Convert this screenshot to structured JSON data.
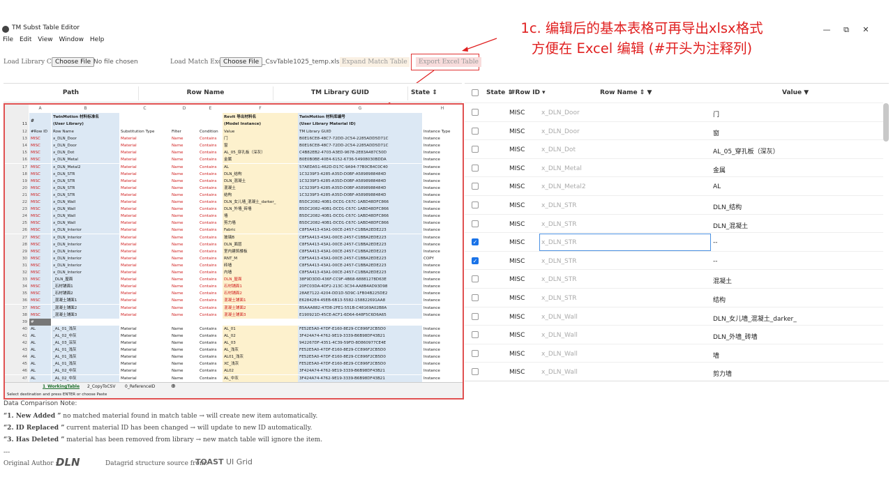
{
  "app": {
    "title": "TM Subst Table Editor"
  },
  "window_controls": [
    "—",
    "⧉",
    "✕"
  ],
  "menu": [
    "File",
    "Edit",
    "View",
    "Window",
    "Help"
  ],
  "annotation": {
    "line1": "1c. 编辑后的基本表格可再导出xlsx格式",
    "line2": "方便在 Excel 编辑 (#开头为注释列)"
  },
  "toolbar": {
    "load_library_label": "Load Library Csv :",
    "choose_file": "Choose File",
    "no_file": "No file chosen",
    "load_match_label": "Load Match Excel :",
    "match_file": "_CsvTable1025_temp.xlsx",
    "expand_match": "Expand Match Table",
    "export_excel": "Export Excel Table"
  },
  "left_header": [
    "Path",
    "Row Name",
    "TM Library GUID",
    "State ⇕"
  ],
  "spreadsheet": {
    "col_letters": [
      "A",
      "B",
      "C",
      "D",
      "E",
      "F",
      "G",
      "H"
    ],
    "header_b": [
      "TwinMotion 材料标准名",
      "(User Library)"
    ],
    "header_f": [
      "Revit 导出材料名",
      "(Model Instance)"
    ],
    "header_g": [
      "TwinMotion 材料库编号",
      "(User Library Material ID)"
    ],
    "header_a": "#",
    "col_header_row": [
      "12",
      "#Row ID",
      "Row Name",
      "Substitution Type",
      "Filter",
      "Condition",
      "Value",
      "TM Library GUID",
      "Instance Type"
    ],
    "rows": [
      [
        "13",
        "MISC",
        "x_DLN_Door",
        "Material",
        "Name",
        "Contains",
        "门",
        "B0E16CE8-48C7-72DD-2C54-2285ADD5D71C",
        "Instance"
      ],
      [
        "14",
        "MISC",
        "x_DLN_Door",
        "Material",
        "Name",
        "Contains",
        "窗",
        "B0E16CE8-48C7-72DD-2C54-2285ADD5D71C",
        "Instance"
      ],
      [
        "15",
        "MISC",
        "x_DLN_Dot",
        "Material",
        "Name",
        "Contains",
        "AL_05_穿孔板（深灰）",
        "C4B82EB2-4703-A3ED-9678-2E83A487C50D",
        "Instance"
      ],
      [
        "16",
        "MISC",
        "x_DLN_Metal",
        "Material",
        "Name",
        "Contains",
        "金属",
        "B0E0B0BE-40E4-6152-6736-54908030BDDA",
        "Instance"
      ],
      [
        "17",
        "MISC",
        "x_DLN_Metal2",
        "Material",
        "Name",
        "Contains",
        "AL",
        "57AEDA51-462D-D17C-9A94-77B0CB4C0C40",
        "Instance"
      ],
      [
        "18",
        "MISC",
        "x_DLN_STR",
        "Material",
        "Name",
        "Contains",
        "DLN_结构",
        "1C3239F3-4285-A35D-D0BF-A5898988484D",
        "Instance"
      ],
      [
        "19",
        "MISC",
        "x_DLN_STR",
        "Material",
        "Name",
        "Contains",
        "DLN_混凝土",
        "1C3239F3-4285-A35D-D0BF-A5898988484D",
        "Instance"
      ],
      [
        "20",
        "MISC",
        "x_DLN_STR",
        "Material",
        "Name",
        "Contains",
        "混凝土",
        "1C3239F3-4285-A35D-D0BF-A5898988484D",
        "Instance"
      ],
      [
        "21",
        "MISC",
        "x_DLN_STR",
        "Material",
        "Name",
        "Contains",
        "结构",
        "1C3239F3-4285-A35D-D0BF-A5898988484D",
        "Instance"
      ],
      [
        "22",
        "MISC",
        "x_DLN_Wall",
        "Material",
        "Name",
        "Contains",
        "DLN_女儿墙_混凝土_darker_",
        "B5DC2082-40B1-DCD1-C67C-1ABD48DFC866",
        "Instance"
      ],
      [
        "23",
        "MISC",
        "x_DLN_Wall",
        "Material",
        "Name",
        "Contains",
        "DLN_外墙_砖墙",
        "B5DC2082-40B1-DCD1-C67C-1ABD48DFC866",
        "Instance"
      ],
      [
        "24",
        "MISC",
        "x_DLN_Wall",
        "Material",
        "Name",
        "Contains",
        "墙",
        "B5DC2082-40B1-DCD1-C67C-1ABD48DFC866",
        "Instance"
      ],
      [
        "25",
        "MISC",
        "x_DLN_Wall",
        "Material",
        "Name",
        "Contains",
        "剪力墙",
        "B5DC2082-40B1-DCD1-C67C-1ABD48DFC866",
        "Instance"
      ],
      [
        "26",
        "MISC",
        "x_DLN_Interior",
        "Material",
        "Name",
        "Contains",
        "Fabric",
        "C8F5A413-43A1-00CE-2457-C1BBA2EDE223",
        "Instance"
      ],
      [
        "27",
        "MISC",
        "x_DLN_Interior",
        "Material",
        "Name",
        "Contains",
        "玻璃B",
        "C8F5A413-43A1-00CE-2457-C1BBA2EDE223",
        "Instance"
      ],
      [
        "28",
        "MISC",
        "x_DLN_Interior",
        "Material",
        "Name",
        "Contains",
        "DLN_面层",
        "C8F5A413-43A1-00CE-2457-C1BBA2EDE223",
        "Instance"
      ],
      [
        "29",
        "MISC",
        "x_DLN_Interior",
        "Material",
        "Name",
        "Contains",
        "室内建筑楼板",
        "C8F5A413-43A1-00CE-2457-C1BBA2EDE223",
        "Instance"
      ],
      [
        "30",
        "MISC",
        "x_DLN_Interior",
        "Material",
        "Name",
        "Contains",
        "RNT_M",
        "C8F5A413-43A1-00CE-2457-C1BBA2EDE223",
        "COPY"
      ],
      [
        "31",
        "MISC",
        "x_DLN_Interior",
        "Material",
        "Name",
        "Contains",
        "砖墙",
        "C8F5A413-43A1-00CE-2457-C1BBA2EDE223",
        "Instance"
      ],
      [
        "32",
        "MISC",
        "x_DLN_Interior",
        "Material",
        "Name",
        "Contains",
        "内墙",
        "C8F5A413-43A1-00CE-2457-C1BBA2EDE223",
        "Instance"
      ],
      [
        "33",
        "MISC",
        "_DLN_屋面",
        "Material",
        "Name",
        "Contains",
        "DLN_屋面",
        "38F9D3DD-436F-CC9F-4B68-68881278D63E",
        "Instance"
      ],
      [
        "34",
        "MISC",
        "_石材铺面1",
        "Material",
        "Name",
        "Contains",
        "石材铺面1",
        "20FC03DA-4DF2-213C-3C34-AA8B4AD93D98",
        "Instance"
      ],
      [
        "35",
        "MISC",
        "_石材铺面2",
        "Material",
        "Name",
        "Contains",
        "石材铺面2",
        "28AE7122-4204-DD1D-5D9C-1FB04B225DE2",
        "Instance"
      ],
      [
        "36",
        "MISC",
        "_混凝土铺面1",
        "Material",
        "Name",
        "Contains",
        "混凝土铺面1",
        "E62842E4-45EB-6B13-5582-158822691AA8",
        "Instance"
      ],
      [
        "37",
        "MISC",
        "_混凝土铺面2",
        "Material",
        "Name",
        "Contains",
        "混凝土铺面2",
        "B5AAA882-47D8-2FE1-551B-C48169A02B8A",
        "Instance"
      ],
      [
        "38",
        "MISC",
        "_混凝土铺面3",
        "Material",
        "Name",
        "Contains",
        "混凝土铺面3",
        "E190921D-45CE-ACF1-6D64-648F5C6D6A65",
        "Instance"
      ],
      [
        "39",
        "#",
        "",
        "",
        "",
        "",
        "",
        "",
        ""
      ],
      [
        "40",
        "AL",
        "_AL_01_浅灰",
        "Material",
        "Name",
        "Contains",
        "AL_01",
        "FE52E5A0-47DF-E160-8E29-CC896F2CB5D0",
        "Instance"
      ],
      [
        "41",
        "AL",
        "_AL_02_中灰",
        "Material",
        "Name",
        "Contains",
        "AL_02",
        "3F424A74-4762-9E19-3339-B6B98DF43B21",
        "Instance"
      ],
      [
        "42",
        "AL",
        "_AL_03_深灰",
        "Material",
        "Name",
        "Contains",
        "AL_03",
        "942267DF-4351-4C39-59FD-8D860977CE4E",
        "Instance"
      ],
      [
        "43",
        "AL",
        "_AL_01_浅灰",
        "Material",
        "Name",
        "Contains",
        "AL_浅灰",
        "FE52E5A0-47DF-E160-8E29-CC896F2CB5D0",
        "Instance"
      ],
      [
        "44",
        "AL",
        "_AL_01_浅灰",
        "Material",
        "Name",
        "Contains",
        "AL01_浅灰",
        "FE52E5A0-47DF-E160-8E29-CC896F2CB5D0",
        "Instance"
      ],
      [
        "45",
        "AL",
        "_AL_01_浅灰",
        "Material",
        "Name",
        "Contains",
        "XC_浅灰",
        "FE52E5A0-47DF-E160-8E29-CC896F2CB5D0",
        "Instance"
      ],
      [
        "46",
        "AL",
        "_AL_02_中灰",
        "Material",
        "Name",
        "Contains",
        "AL02",
        "3F424A74-4762-9E19-3339-B6B98DF43B21",
        "Instance"
      ],
      [
        "47",
        "AL",
        "_AL_02_中灰",
        "Material",
        "Name",
        "Contains",
        "AL_中灰",
        "3F424A74-4762-9E19-3339-B6B98DF43B21",
        "Instance"
      ]
    ],
    "tabs": [
      "1_WorkingTable",
      "2_CopyToCSV",
      "0_ReferenceID"
    ],
    "status": "Select destination and press ENTER or choose Paste"
  },
  "right_header": [
    "State ⇕",
    "#Row ID ▾",
    "Row Name ⇕ ▼",
    "Value ▼"
  ],
  "right_rows": [
    {
      "checked": false,
      "row_id": "MISC",
      "row_name": "x_DLN_Door",
      "value": "门"
    },
    {
      "checked": false,
      "row_id": "MISC",
      "row_name": "x_DLN_Door",
      "value": "窗"
    },
    {
      "checked": false,
      "row_id": "MISC",
      "row_name": "x_DLN_Dot",
      "value": "AL_05_穿孔板（深灰）"
    },
    {
      "checked": false,
      "row_id": "MISC",
      "row_name": "x_DLN_Metal",
      "value": "金属"
    },
    {
      "checked": false,
      "row_id": "MISC",
      "row_name": "x_DLN_Metal2",
      "value": "AL"
    },
    {
      "checked": false,
      "row_id": "MISC",
      "row_name": "x_DLN_STR",
      "value": "DLN_结构"
    },
    {
      "checked": false,
      "row_id": "MISC",
      "row_name": "x_DLN_STR",
      "value": "DLN_混凝土"
    },
    {
      "checked": true,
      "row_id": "MISC",
      "row_name": "x_DLN_STR",
      "value": "--"
    },
    {
      "checked": true,
      "row_id": "MISC",
      "row_name": "x_DLN_STR",
      "value": "--"
    },
    {
      "checked": false,
      "row_id": "MISC",
      "row_name": "x_DLN_STR",
      "value": "混凝土"
    },
    {
      "checked": false,
      "row_id": "MISC",
      "row_name": "x_DLN_STR",
      "value": "结构"
    },
    {
      "checked": false,
      "row_id": "MISC",
      "row_name": "x_DLN_Wall",
      "value": "DLN_女儿墙_混凝土_darker_"
    },
    {
      "checked": false,
      "row_id": "MISC",
      "row_name": "x_DLN_Wall",
      "value": "DLN_外墙_砖墙"
    },
    {
      "checked": false,
      "row_id": "MISC",
      "row_name": "x_DLN_Wall",
      "value": "墙"
    },
    {
      "checked": false,
      "row_id": "MISC",
      "row_name": "x_DLN_Wall",
      "value": "剪力墙"
    }
  ],
  "notes": {
    "title": "Data Comparison Note:",
    "n1_bold": "“1. New Added ”",
    "n1": " no matched material found in match table → will create new item automatically.",
    "n2_bold": "“2. ID Replaced ”",
    "n2": " current material ID has been changed → will update to new ID automatically.",
    "n3_bold": "“3. Has Deleted ”",
    "n3": " material has been removed from library → new match table will ignore the item.",
    "dashes": "---"
  },
  "credits": {
    "author_label": "Original Author :",
    "author_logo": "DLN",
    "grid_label": "Datagrid structure source from:",
    "grid_logo_bold": "TOAST",
    "grid_logo": "UI Grid"
  },
  "colors": {
    "accent_red": "#e02020",
    "checkbox_blue": "#1a73e8",
    "guid_blue": "#dce8f4",
    "value_yellow": "#fdf1cd"
  }
}
